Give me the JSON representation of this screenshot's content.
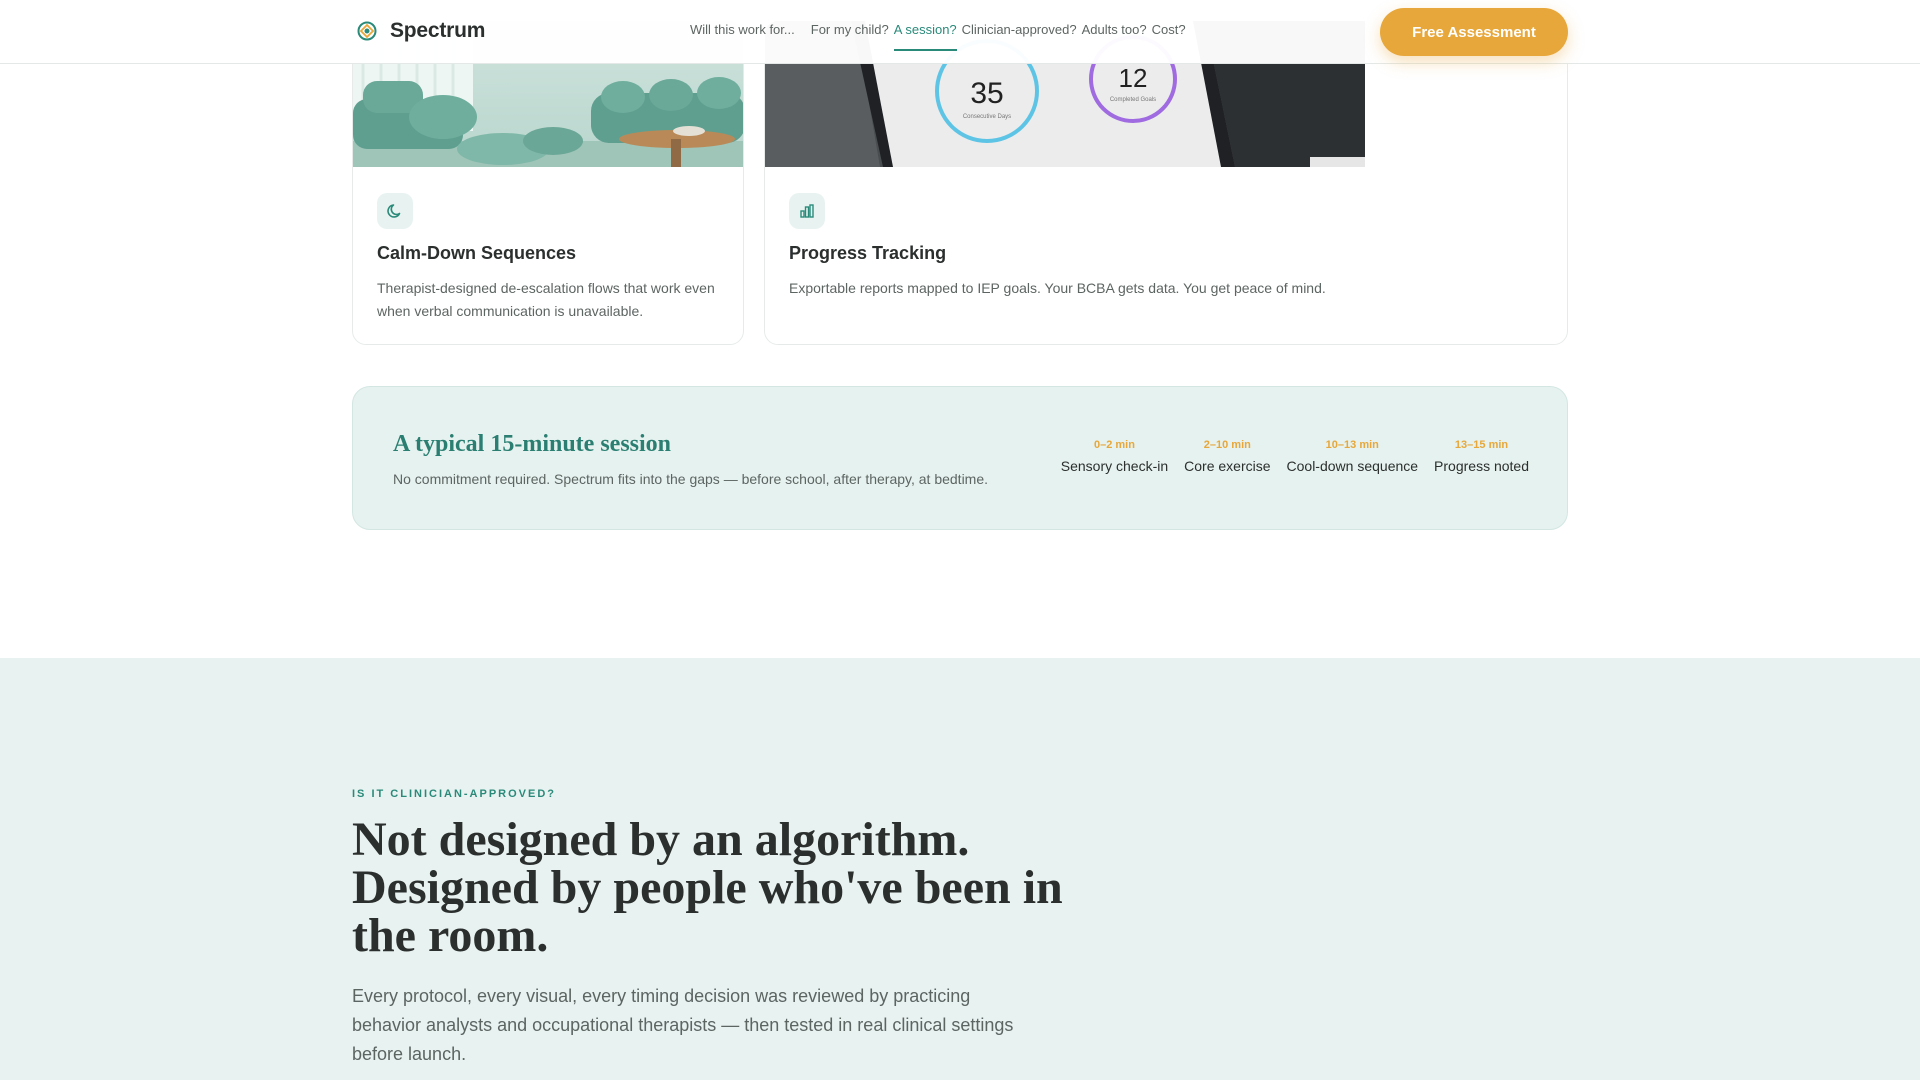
{
  "brand": {
    "name": "Spectrum"
  },
  "nav": {
    "lead": "Will this work for...",
    "items": [
      "For my child?",
      "A session?",
      "Clinician-approved?",
      "Adults too?",
      "Cost?"
    ],
    "active_index": 1
  },
  "cta": {
    "label": "Free Assessment"
  },
  "features": [
    {
      "title": "Calm-Down Sequences",
      "description": "Therapist-designed de-escalation flows that work even when verbal communication is unavailable.",
      "icon": "moon-icon"
    },
    {
      "title": "Progress Tracking",
      "description": "Exportable reports mapped to IEP goals. Your BCBA gets data. You get peace of mind.",
      "icon": "bar-chart-icon",
      "image_stats": [
        {
          "value": "35",
          "caption": "Consecutive Days"
        },
        {
          "value": "12",
          "caption": "Completed Goals"
        }
      ]
    }
  ],
  "session": {
    "title": "A typical 15-minute session",
    "subtitle": "No commitment required. Spectrum fits into the gaps — before school, after therapy, at bedtime.",
    "steps": [
      {
        "time": "0–2 min",
        "label": "Sensory check-in"
      },
      {
        "time": "2–10 min",
        "label": "Core exercise"
      },
      {
        "time": "10–13 min",
        "label": "Cool-down sequence"
      },
      {
        "time": "13–15 min",
        "label": "Progress noted"
      }
    ]
  },
  "clinician": {
    "eyebrow": "IS IT CLINICIAN-APPROVED?",
    "headline": "Not designed by an algorithm. Designed by people who've been in the room.",
    "body": "Every protocol, every visual, every timing decision was reviewed by practicing behavior analysts and occupational therapists — then tested in real clinical settings before launch."
  },
  "colors": {
    "accent": "#2a8a7a",
    "cta": "#e7a73a",
    "band": "#e6f2ef"
  }
}
